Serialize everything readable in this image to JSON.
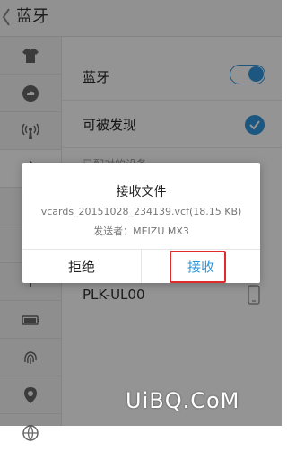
{
  "header": {
    "title": "蓝牙"
  },
  "sidebar": {
    "items": [
      {
        "icon": "shirt-icon"
      },
      {
        "icon": "cloud-icon"
      },
      {
        "icon": "hotspot-icon"
      },
      {
        "icon": "bluetooth-icon"
      },
      {
        "icon": "wifi-icon"
      },
      {
        "icon": "sim-icon"
      },
      {
        "icon": "dual-sim-icon"
      },
      {
        "icon": "battery-icon"
      },
      {
        "icon": "fingerprint-icon"
      },
      {
        "icon": "location-icon"
      },
      {
        "icon": "globe-icon"
      }
    ]
  },
  "settings": {
    "bluetooth_label": "蓝牙",
    "bluetooth_on": true,
    "discoverable_label": "可被发现",
    "discoverable_on": true,
    "paired_section": "已配对的设备",
    "devices": [
      {
        "name": "PLK-UL00"
      }
    ]
  },
  "dialog": {
    "title": "接收文件",
    "file": "vcards_20151028_234139.vcf(18.15 KB)",
    "sender_label": "发送者：",
    "sender": "MEIZU MX3",
    "reject": "拒绝",
    "accept": "接收"
  },
  "watermark": "UiBQ.CoM",
  "colors": {
    "accent": "#2f97dc",
    "highlight": "#e02b2b"
  }
}
